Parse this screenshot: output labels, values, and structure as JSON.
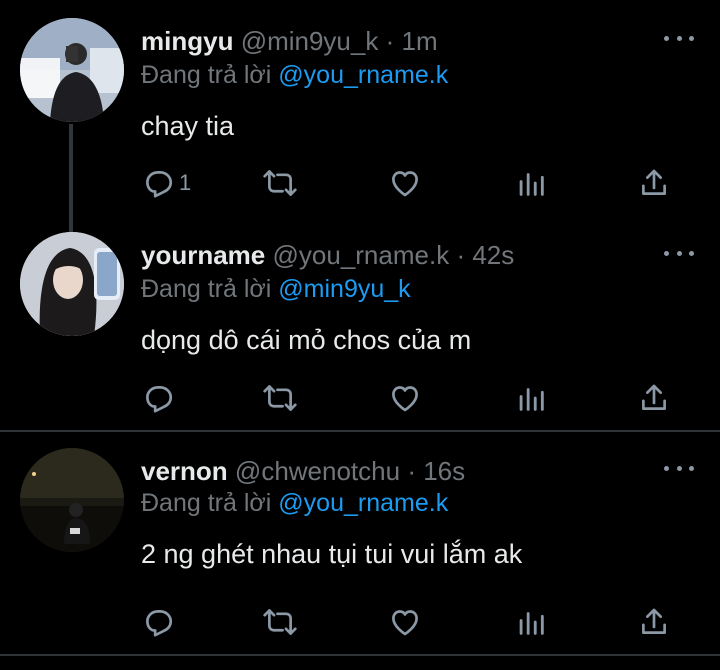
{
  "tweets": [
    {
      "name": "mingyu",
      "handle": "@min9yu_k",
      "separator": "·",
      "time": "1m",
      "reply_prefix": "Đang trả lời",
      "reply_to": "@you_rname.k",
      "text": "chay tia",
      "reply_count": "1"
    },
    {
      "name": "yourname",
      "handle": "@you_rname.k",
      "separator": "·",
      "time": "42s",
      "reply_prefix": "Đang trả lời",
      "reply_to": "@min9yu_k",
      "text": "dọng dô cái mỏ chos của m",
      "reply_count": ""
    },
    {
      "name": "vernon",
      "handle": "@chwenotchu",
      "separator": "·",
      "time": "16s",
      "reply_prefix": "Đang trả lời",
      "reply_to": "@you_rname.k",
      "text": "2 ng ghét nhau tụi tui vui lắm ak",
      "reply_count": ""
    }
  ],
  "colors": {
    "background": "#000000",
    "text": "#e7e9ea",
    "muted": "#71767b",
    "mention": "#1d9bf0",
    "icon": "#8b98a5"
  },
  "icons": [
    "reply-icon",
    "retweet-icon",
    "like-icon",
    "views-icon",
    "share-icon",
    "more-icon"
  ]
}
